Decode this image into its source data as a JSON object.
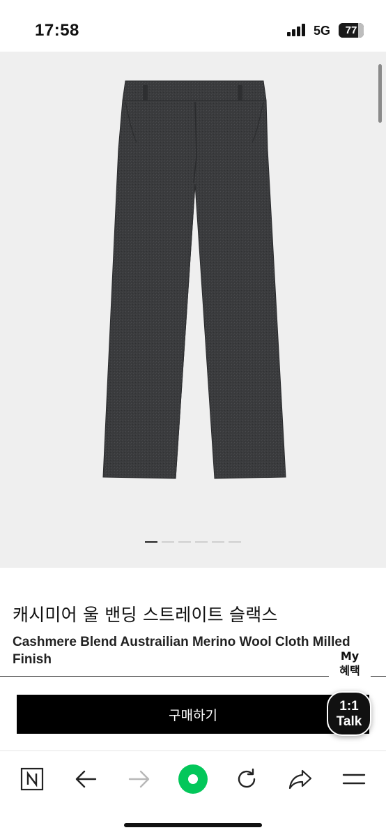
{
  "status_bar": {
    "time": "17:58",
    "network": "5G",
    "battery": "77",
    "battery_level": 0.77
  },
  "gallery": {
    "pages": 6,
    "active_index": 0
  },
  "product": {
    "title_ko": "캐시미어 울 밴딩 스트레이트 슬랙스",
    "title_en": "Cashmere Blend Austrailian Merino Wool Cloth Milled Finish"
  },
  "floating": {
    "my_benefit": [
      "My",
      "혜택"
    ],
    "talk": [
      "1:1",
      "Talk"
    ]
  },
  "actions": {
    "buy_label": "구매하기"
  },
  "browser_bar": {
    "icons": [
      "naver-n-icon",
      "back-arrow-icon",
      "forward-arrow-icon",
      "green-dot-home-icon",
      "refresh-icon",
      "share-icon",
      "menu-icon"
    ],
    "accent_color": "#03c75a"
  }
}
